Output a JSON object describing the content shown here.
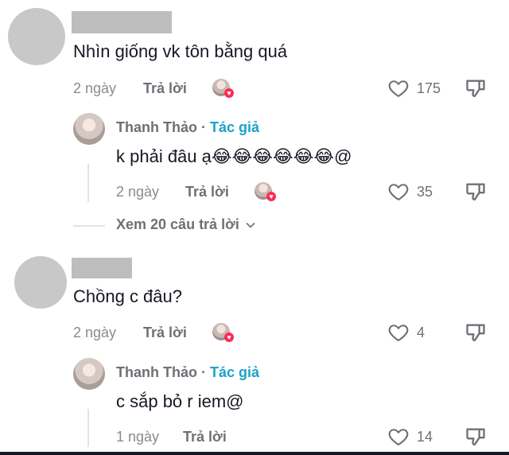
{
  "comments": [
    {
      "text": "Nhìn giống vk tôn bằng quá",
      "time": "2 ngày",
      "reply_label": "Trả lời",
      "likes": "175",
      "reply": {
        "author": "Thanh Thảo",
        "separator": " · ",
        "tag": "Tác giả",
        "text": "k phải đâu ạ😂😂😂😂😂😂@",
        "time": "2 ngày",
        "reply_label": "Trả lời",
        "likes": "35"
      },
      "view_more": "Xem 20 câu trả lời"
    },
    {
      "text": "Chồng c đâu?",
      "time": "2 ngày",
      "reply_label": "Trả lời",
      "likes": "4",
      "reply": {
        "author": "Thanh Thảo",
        "separator": " · ",
        "tag": "Tác giả",
        "text": "c sắp bỏ r iem@",
        "time": "1 ngày",
        "reply_label": "Trả lời",
        "likes": "14"
      }
    }
  ],
  "icons": {
    "like": "heart-outline-icon",
    "dislike": "thumbs-down-icon",
    "chevron": "chevron-down-icon"
  },
  "colors": {
    "author_tag": "#1aa3c8",
    "heart_badge": "#fe2c55",
    "secondary_text": "#8a8b91"
  }
}
